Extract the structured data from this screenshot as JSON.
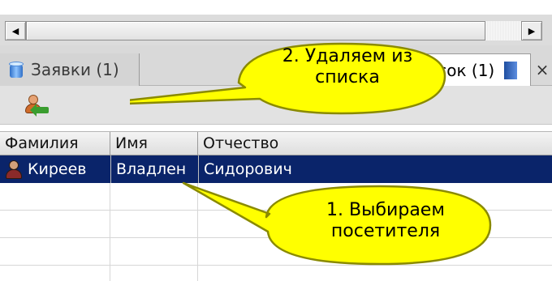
{
  "scrollbar": {
    "left_arrow": "◀",
    "right_arrow": "▶"
  },
  "tabs": [
    {
      "label": "Заявки (1)",
      "icon": "jar-icon"
    },
    {
      "label": "ый список (1)",
      "icon": "list-flag-icon",
      "active": true
    }
  ],
  "close_label": "×",
  "toolbar": {
    "remove_button_icon": "remove-visitor-icon"
  },
  "grid": {
    "columns": [
      "Фамилия",
      "Имя",
      "Отчество"
    ],
    "rows": [
      {
        "surname": "Киреев",
        "name": "Владлен",
        "patronymic": "Сидорович",
        "selected": true,
        "icon": "person-icon"
      }
    ],
    "empty_rows": 3
  },
  "callouts": {
    "delete": {
      "line1": "2. Удаляем из",
      "line2": "списка"
    },
    "select": {
      "line1": "1. Выбираем",
      "line2": "посетителя"
    }
  },
  "colors": {
    "selection": "#0a246a",
    "callout_fill": "#ffff00",
    "callout_stroke": "#8a8a00"
  }
}
